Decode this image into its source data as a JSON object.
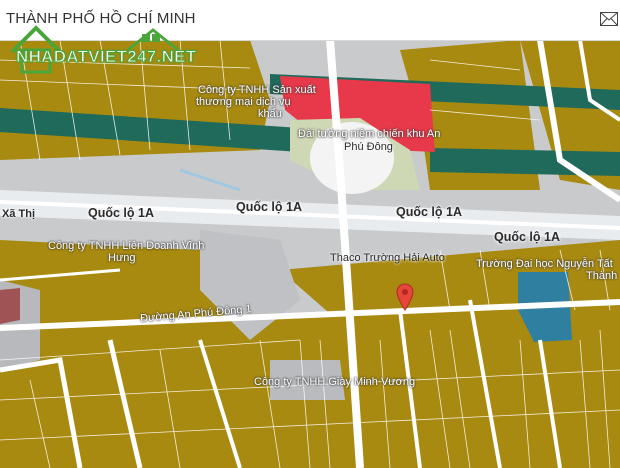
{
  "header": {
    "title": "THÀNH PHỐ HỒ CHÍ MINH",
    "mail_icon": "envelope-icon"
  },
  "logo": {
    "text": "NHADATVIET247.NET",
    "icon": "house-icon"
  },
  "map": {
    "colors": {
      "residential": "#a88a10",
      "commercial": "#e8394a",
      "green": "#1f6a5a",
      "water": "#2f7fa0",
      "road": "#e9ecef",
      "base": "#c8cacc"
    },
    "labels": {
      "company_top_1": "Công ty TNHH Sản xuất",
      "company_top_2": "thương mại dịch vụ",
      "company_top_3": "khẩu",
      "memorial_1": "Đài tưởng niệm chiến khu An",
      "memorial_2": "Phú Đông",
      "ql1a_left": "Quốc lộ 1A",
      "ql1a_center": "Quốc lộ 1A",
      "ql1a_right": "Quốc lộ 1A",
      "ql1a_far_right": "Quốc lộ 1A",
      "company_joint_1": "Công ty TNHH Liên Doanh Vĩnh",
      "company_joint_2": "Hưng",
      "thaco": "Thaco Trường Hải Auto",
      "university_1": "Trường Đại học Nguyễn Tất",
      "university_2": "Thành",
      "road_anphudong": "Đường An Phú Đông 1",
      "company_shoes": "Công ty TNHH Giày Minh Vương",
      "partial_left": "Xã Thị"
    },
    "pin_icon": "location-pin-icon"
  }
}
